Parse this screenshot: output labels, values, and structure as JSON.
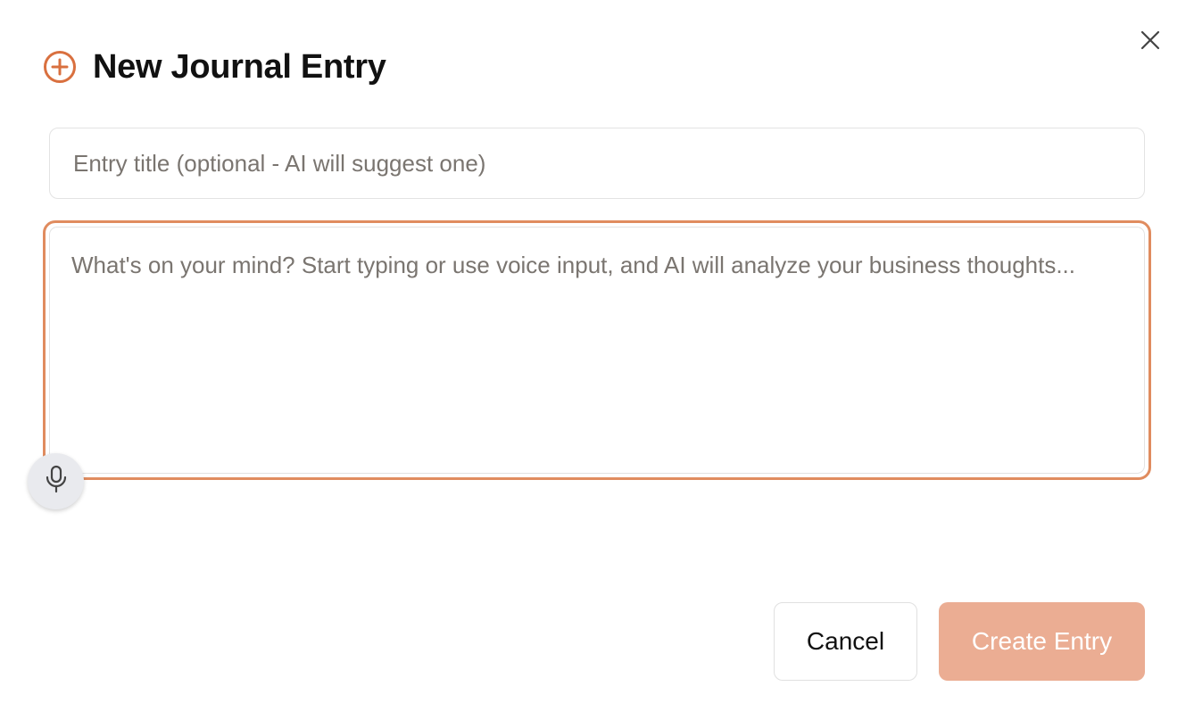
{
  "dialog": {
    "title": "New Journal Entry",
    "header_icon": "plus-circle-icon",
    "close_icon": "close-icon"
  },
  "form": {
    "title_input": {
      "value": "",
      "placeholder": "Entry title (optional - AI will suggest one)"
    },
    "body_input": {
      "value": "",
      "placeholder": "What's on your mind? Start typing or use voice input, and AI will analyze your business thoughts..."
    },
    "voice_button_icon": "microphone-icon"
  },
  "footer": {
    "cancel_label": "Cancel",
    "create_label": "Create Entry"
  },
  "colors": {
    "accent": "#e08c5f",
    "create_button_bg": "#ebad93",
    "mic_button_bg": "#e9eaee"
  }
}
